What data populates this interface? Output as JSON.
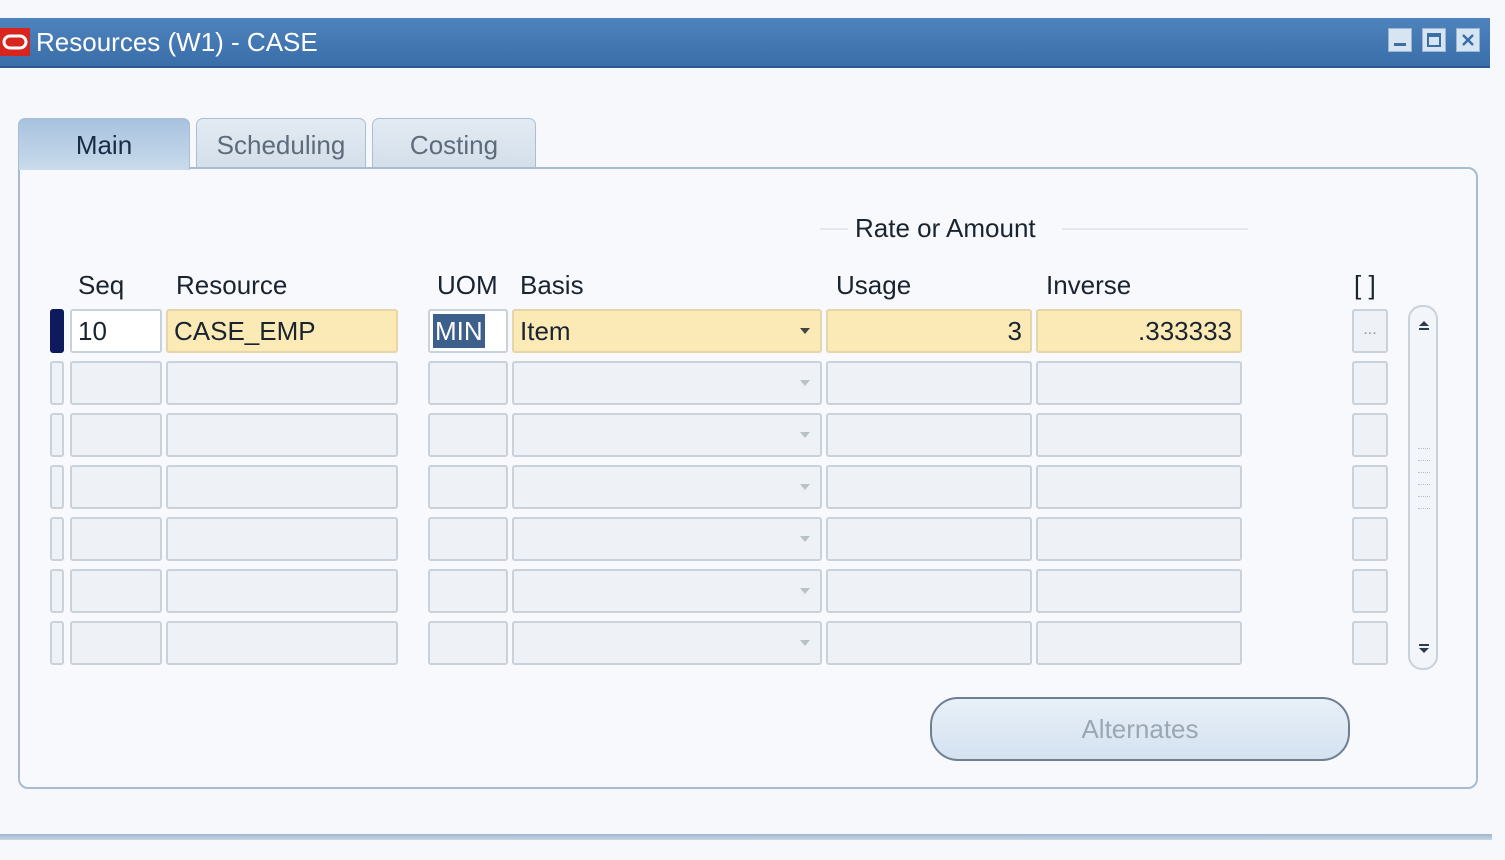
{
  "window": {
    "title": "Resources (W1) - CASE",
    "controls": [
      "minimize",
      "maximize",
      "close"
    ]
  },
  "tabs": [
    {
      "label": "Main",
      "active": true
    },
    {
      "label": "Scheduling",
      "active": false
    },
    {
      "label": "Costing",
      "active": false
    }
  ],
  "group": {
    "title": "Rate or Amount"
  },
  "columns": {
    "seq": "Seq",
    "resource": "Resource",
    "uom": "UOM",
    "basis": "Basis",
    "usage": "Usage",
    "inverse": "Inverse",
    "dff": "[ ]"
  },
  "rows": [
    {
      "seq": "10",
      "resource": "CASE_EMP",
      "uom": "MIN",
      "basis": "Item",
      "usage": "3",
      "inverse": ".333333",
      "dff": "..."
    },
    {
      "seq": "",
      "resource": "",
      "uom": "",
      "basis": "",
      "usage": "",
      "inverse": "",
      "dff": ""
    },
    {
      "seq": "",
      "resource": "",
      "uom": "",
      "basis": "",
      "usage": "",
      "inverse": "",
      "dff": ""
    },
    {
      "seq": "",
      "resource": "",
      "uom": "",
      "basis": "",
      "usage": "",
      "inverse": "",
      "dff": ""
    },
    {
      "seq": "",
      "resource": "",
      "uom": "",
      "basis": "",
      "usage": "",
      "inverse": "",
      "dff": ""
    },
    {
      "seq": "",
      "resource": "",
      "uom": "",
      "basis": "",
      "usage": "",
      "inverse": "",
      "dff": ""
    },
    {
      "seq": "",
      "resource": "",
      "uom": "",
      "basis": "",
      "usage": "",
      "inverse": "",
      "dff": ""
    }
  ],
  "buttons": {
    "alternates": "Alternates"
  },
  "colors": {
    "titlebar": "#3a6ea8",
    "required_field": "#fbeab5",
    "current_record": "#0e1a5c",
    "selection": "#3d5f8c"
  }
}
